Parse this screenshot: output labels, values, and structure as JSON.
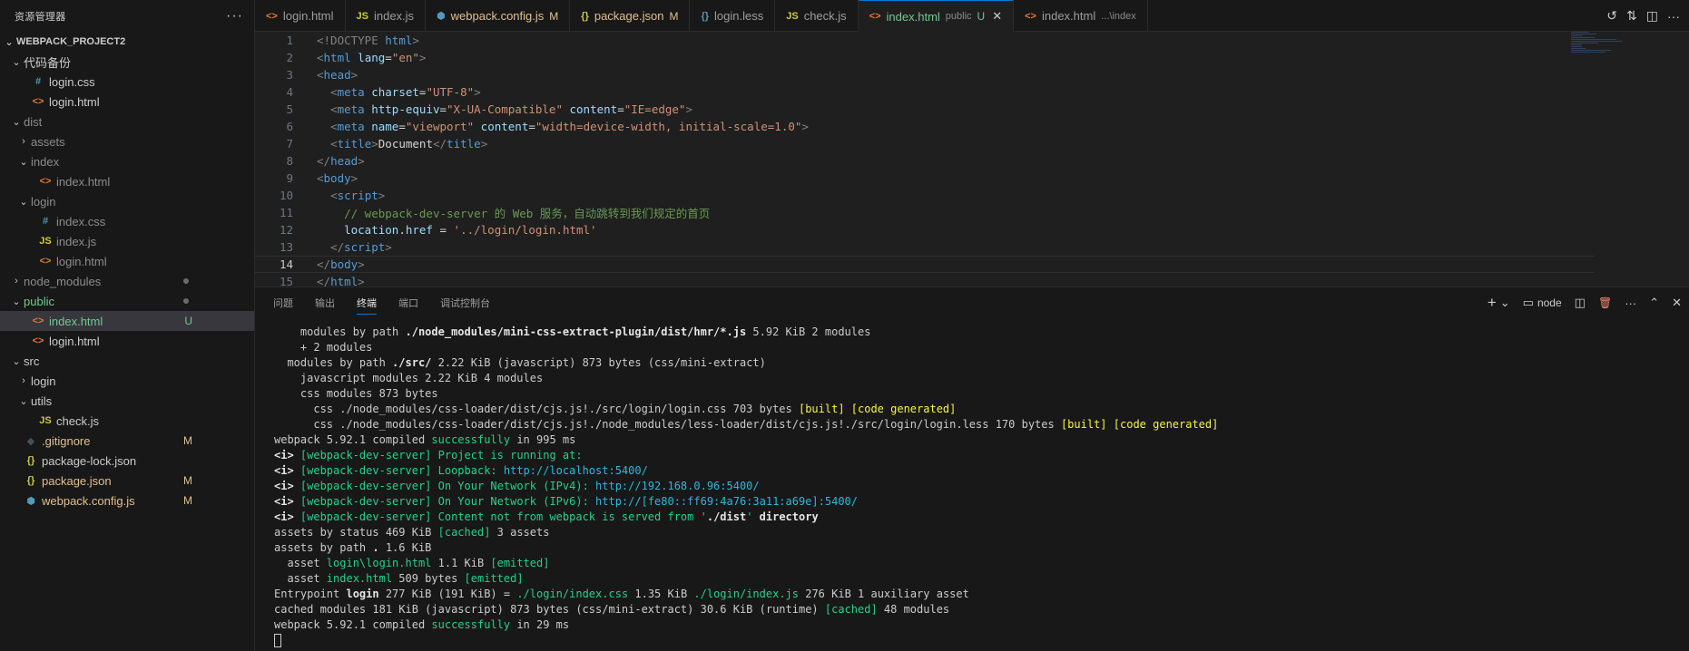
{
  "explorer": {
    "title": "资源管理器",
    "more": "···",
    "tree": [
      {
        "label": "WEBPACK_PROJECT2",
        "depth": 0,
        "chev": "⌄",
        "kind": "root"
      },
      {
        "label": "代码备份",
        "depth": 1,
        "chev": "⌄",
        "kind": "folder"
      },
      {
        "label": "login.css",
        "depth": 2,
        "icon": "#",
        "icon_class": "c-css",
        "kind": "file"
      },
      {
        "label": "login.html",
        "depth": 2,
        "icon": "<>",
        "icon_class": "c-html",
        "kind": "file"
      },
      {
        "label": "dist",
        "depth": 1,
        "chev": "⌄",
        "kind": "folder",
        "status": "ignored"
      },
      {
        "label": "assets",
        "depth": 2,
        "chev": "›",
        "kind": "folder",
        "status": "ignored"
      },
      {
        "label": "index",
        "depth": 2,
        "chev": "⌄",
        "kind": "folder",
        "status": "ignored"
      },
      {
        "label": "index.html",
        "depth": 3,
        "icon": "<>",
        "icon_class": "c-html",
        "kind": "file",
        "status": "ignored"
      },
      {
        "label": "login",
        "depth": 2,
        "chev": "⌄",
        "kind": "folder",
        "status": "ignored"
      },
      {
        "label": "index.css",
        "depth": 3,
        "icon": "#",
        "icon_class": "c-css",
        "kind": "file",
        "status": "ignored"
      },
      {
        "label": "index.js",
        "depth": 3,
        "icon": "JS",
        "icon_class": "c-js",
        "kind": "file",
        "status": "ignored"
      },
      {
        "label": "login.html",
        "depth": 3,
        "icon": "<>",
        "icon_class": "c-html",
        "kind": "file",
        "status": "ignored"
      },
      {
        "label": "node_modules",
        "depth": 1,
        "chev": "›",
        "kind": "folder",
        "status": "ignored",
        "dot": true
      },
      {
        "label": "public",
        "depth": 1,
        "chev": "⌄",
        "kind": "folder",
        "status": "untracked",
        "dot": true
      },
      {
        "label": "index.html",
        "depth": 2,
        "icon": "<>",
        "icon_class": "c-html",
        "kind": "file",
        "status": "untracked",
        "badge": "U",
        "selected": true
      },
      {
        "label": "login.html",
        "depth": 2,
        "icon": "<>",
        "icon_class": "c-html",
        "kind": "file"
      },
      {
        "label": "src",
        "depth": 1,
        "chev": "⌄",
        "kind": "folder"
      },
      {
        "label": "login",
        "depth": 2,
        "chev": "›",
        "kind": "folder"
      },
      {
        "label": "utils",
        "depth": 2,
        "chev": "⌄",
        "kind": "folder"
      },
      {
        "label": "check.js",
        "depth": 3,
        "icon": "JS",
        "icon_class": "c-js",
        "kind": "file"
      },
      {
        "label": ".gitignore",
        "depth": 1,
        "icon": "◆",
        "icon_class": "c-git",
        "kind": "file",
        "status": "mod",
        "badge": "M"
      },
      {
        "label": "package-lock.json",
        "depth": 1,
        "icon": "{}",
        "icon_class": "c-json",
        "kind": "file"
      },
      {
        "label": "package.json",
        "depth": 1,
        "icon": "{}",
        "icon_class": "c-json",
        "kind": "file",
        "status": "mod",
        "badge": "M"
      },
      {
        "label": "webpack.config.js",
        "depth": 1,
        "icon": "⬢",
        "icon_class": "c-webpack",
        "kind": "file",
        "status": "mod",
        "badge": "M"
      }
    ]
  },
  "tabs": [
    {
      "label": "login.html",
      "icon": "<>",
      "icon_class": "c-html"
    },
    {
      "label": "index.js",
      "icon": "JS",
      "icon_class": "c-js"
    },
    {
      "label": "webpack.config.js",
      "icon": "⬢",
      "icon_class": "c-webpack",
      "mark": "M",
      "modified": true
    },
    {
      "label": "package.json",
      "icon": "{}",
      "icon_class": "c-json",
      "mark": "M",
      "modified": true
    },
    {
      "label": "login.less",
      "icon": "{}",
      "icon_class": "c-css"
    },
    {
      "label": "check.js",
      "icon": "JS",
      "icon_class": "c-js"
    },
    {
      "label": "index.html",
      "icon": "<>",
      "icon_class": "c-html",
      "desc": "public",
      "mark": "U",
      "active": true,
      "close": "✕"
    },
    {
      "label": "index.html",
      "icon": "<>",
      "icon_class": "c-html",
      "desc": "...\\index"
    }
  ],
  "tab_actions": [
    "↺",
    "⇅",
    "◫",
    "···"
  ],
  "editor": {
    "current_line": 14,
    "lines": [
      [
        [
          "t-tag",
          "<!DOCTYPE "
        ],
        [
          "t-name",
          "html"
        ],
        [
          "t-tag",
          ">"
        ]
      ],
      [
        [
          "t-tag",
          "<"
        ],
        [
          "t-name",
          "html "
        ],
        [
          "t-attr",
          "lang"
        ],
        [
          "t-txt",
          "="
        ],
        [
          "t-str",
          "\"en\""
        ],
        [
          "t-tag",
          ">"
        ]
      ],
      [
        [
          "t-tag",
          "<"
        ],
        [
          "t-name",
          "head"
        ],
        [
          "t-tag",
          ">"
        ]
      ],
      [
        [
          "t-txt",
          "  "
        ],
        [
          "t-tag",
          "<"
        ],
        [
          "t-name",
          "meta "
        ],
        [
          "t-attr",
          "charset"
        ],
        [
          "t-txt",
          "="
        ],
        [
          "t-str",
          "\"UTF-8\""
        ],
        [
          "t-tag",
          ">"
        ]
      ],
      [
        [
          "t-txt",
          "  "
        ],
        [
          "t-tag",
          "<"
        ],
        [
          "t-name",
          "meta "
        ],
        [
          "t-attr",
          "http-equiv"
        ],
        [
          "t-txt",
          "="
        ],
        [
          "t-str",
          "\"X-UA-Compatible\" "
        ],
        [
          "t-attr",
          "content"
        ],
        [
          "t-txt",
          "="
        ],
        [
          "t-str",
          "\"IE=edge\""
        ],
        [
          "t-tag",
          ">"
        ]
      ],
      [
        [
          "t-txt",
          "  "
        ],
        [
          "t-tag",
          "<"
        ],
        [
          "t-name",
          "meta "
        ],
        [
          "t-attr",
          "name"
        ],
        [
          "t-txt",
          "="
        ],
        [
          "t-str",
          "\"viewport\" "
        ],
        [
          "t-attr",
          "content"
        ],
        [
          "t-txt",
          "="
        ],
        [
          "t-str",
          "\"width=device-width, initial-scale=1.0\""
        ],
        [
          "t-tag",
          ">"
        ]
      ],
      [
        [
          "t-txt",
          "  "
        ],
        [
          "t-tag",
          "<"
        ],
        [
          "t-name",
          "title"
        ],
        [
          "t-tag",
          ">"
        ],
        [
          "t-txt",
          "Document"
        ],
        [
          "t-tag",
          "</"
        ],
        [
          "t-name",
          "title"
        ],
        [
          "t-tag",
          ">"
        ]
      ],
      [
        [
          "t-tag",
          "</"
        ],
        [
          "t-name",
          "head"
        ],
        [
          "t-tag",
          ">"
        ]
      ],
      [
        [
          "t-tag",
          "<"
        ],
        [
          "t-name",
          "body"
        ],
        [
          "t-tag",
          ">"
        ]
      ],
      [
        [
          "t-txt",
          "  "
        ],
        [
          "t-tag",
          "<"
        ],
        [
          "t-name",
          "script"
        ],
        [
          "t-tag",
          ">"
        ]
      ],
      [
        [
          "t-txt",
          "    "
        ],
        [
          "t-cmt",
          "// webpack-dev-server 的 Web 服务，自动跳转到我们规定的首页"
        ]
      ],
      [
        [
          "t-txt",
          "    "
        ],
        [
          "t-var",
          "location"
        ],
        [
          "t-txt",
          "."
        ],
        [
          "t-var",
          "href"
        ],
        [
          "t-txt",
          " = "
        ],
        [
          "t-str",
          "'../login/login.html'"
        ]
      ],
      [
        [
          "t-txt",
          "  "
        ],
        [
          "t-tag",
          "</"
        ],
        [
          "t-name",
          "script"
        ],
        [
          "t-tag",
          ">"
        ]
      ],
      [
        [
          "t-tag",
          "</"
        ],
        [
          "t-name",
          "body"
        ],
        [
          "t-tag",
          ">"
        ]
      ],
      [
        [
          "t-tag",
          "</"
        ],
        [
          "t-name",
          "html"
        ],
        [
          "t-tag",
          ">"
        ]
      ]
    ]
  },
  "panel": {
    "tabs": [
      "问题",
      "输出",
      "终端",
      "端口",
      "调试控制台"
    ],
    "active_tab": 2,
    "shell_label": "node",
    "actions": {
      "add": "+",
      "dropdown": "⌄",
      "terminal": "▭",
      "split": "◫",
      "trash": "🗑",
      "more": "···",
      "maximize": "⌃",
      "close": "✕"
    }
  },
  "terminal": [
    [
      [
        "",
        "    modules by path "
      ],
      [
        "b",
        "./node_modules/mini-css-extract-plugin/dist/hmr/*.js"
      ],
      [
        "",
        " 5.92 KiB 2 modules"
      ]
    ],
    [
      [
        "",
        "    + 2 modules"
      ]
    ],
    [
      [
        "",
        "  modules by path "
      ],
      [
        "b",
        "./src/"
      ],
      [
        "",
        " 2.22 KiB (javascript) 873 bytes (css/mini-extract)"
      ]
    ],
    [
      [
        "",
        "    javascript modules 2.22 KiB 4 modules"
      ]
    ],
    [
      [
        "",
        "    css modules 873 bytes"
      ]
    ],
    [
      [
        "",
        "      css ./node_modules/css-loader/dist/cjs.js!./src/login/login.css 703 bytes "
      ],
      [
        "y",
        "[built]"
      ],
      [
        "",
        " "
      ],
      [
        "y",
        "[code generated]"
      ]
    ],
    [
      [
        "",
        "      css ./node_modules/css-loader/dist/cjs.js!./node_modules/less-loader/dist/cjs.js!./src/login/login.less 170 bytes "
      ],
      [
        "y",
        "[built]"
      ],
      [
        "",
        " "
      ],
      [
        "y",
        "[code generated]"
      ]
    ],
    [
      [
        "",
        "webpack 5.92.1 compiled "
      ],
      [
        "g",
        "successfully"
      ],
      [
        "",
        " in 995 ms"
      ]
    ],
    [
      [
        "b",
        "<i> "
      ],
      [
        "g",
        "[webpack-dev-server] Project is running at:"
      ]
    ],
    [
      [
        "b",
        "<i> "
      ],
      [
        "g",
        "[webpack-dev-server] Loopback: "
      ],
      [
        "cy",
        "http://localhost:5400/"
      ]
    ],
    [
      [
        "b",
        "<i> "
      ],
      [
        "g",
        "[webpack-dev-server] On Your Network (IPv4): "
      ],
      [
        "cy",
        "http://192.168.0.96:5400/"
      ]
    ],
    [
      [
        "b",
        "<i> "
      ],
      [
        "g",
        "[webpack-dev-server] On Your Network (IPv6): "
      ],
      [
        "cy",
        "http://[fe80::ff69:4a76:3a11:a69e]:5400/"
      ]
    ],
    [
      [
        "b",
        "<i> "
      ],
      [
        "g",
        "[webpack-dev-server] Content not from webpack is served from '"
      ],
      [
        "b",
        "./dist"
      ],
      [
        "g",
        "'"
      ],
      [
        "b",
        " directory"
      ]
    ],
    [
      [
        "",
        "assets by status 469 KiB "
      ],
      [
        "g",
        "[cached]"
      ],
      [
        "",
        " 3 assets"
      ]
    ],
    [
      [
        "",
        "assets by path "
      ],
      [
        "b",
        "."
      ],
      [
        "",
        " 1.6 KiB"
      ]
    ],
    [
      [
        "",
        "  asset "
      ],
      [
        "g",
        "login\\login.html"
      ],
      [
        "",
        " 1.1 KiB "
      ],
      [
        "g",
        "[emitted]"
      ]
    ],
    [
      [
        "",
        "  asset "
      ],
      [
        "g",
        "index.html"
      ],
      [
        "",
        " 509 bytes "
      ],
      [
        "g",
        "[emitted]"
      ]
    ],
    [
      [
        "",
        "Entrypoint "
      ],
      [
        "b",
        "login"
      ],
      [
        "",
        " 277 KiB (191 KiB) = "
      ],
      [
        "g",
        "./login/index.css"
      ],
      [
        "",
        " 1.35 KiB "
      ],
      [
        "g",
        "./login/index.js"
      ],
      [
        "",
        " 276 KiB 1 auxiliary asset"
      ]
    ],
    [
      [
        "",
        "cached modules 181 KiB (javascript) 873 bytes (css/mini-extract) 30.6 KiB (runtime) "
      ],
      [
        "g",
        "[cached]"
      ],
      [
        "",
        " 48 modules"
      ]
    ],
    [
      [
        "",
        "webpack 5.92.1 compiled "
      ],
      [
        "g",
        "successfully"
      ],
      [
        "",
        " in 29 ms"
      ]
    ]
  ]
}
